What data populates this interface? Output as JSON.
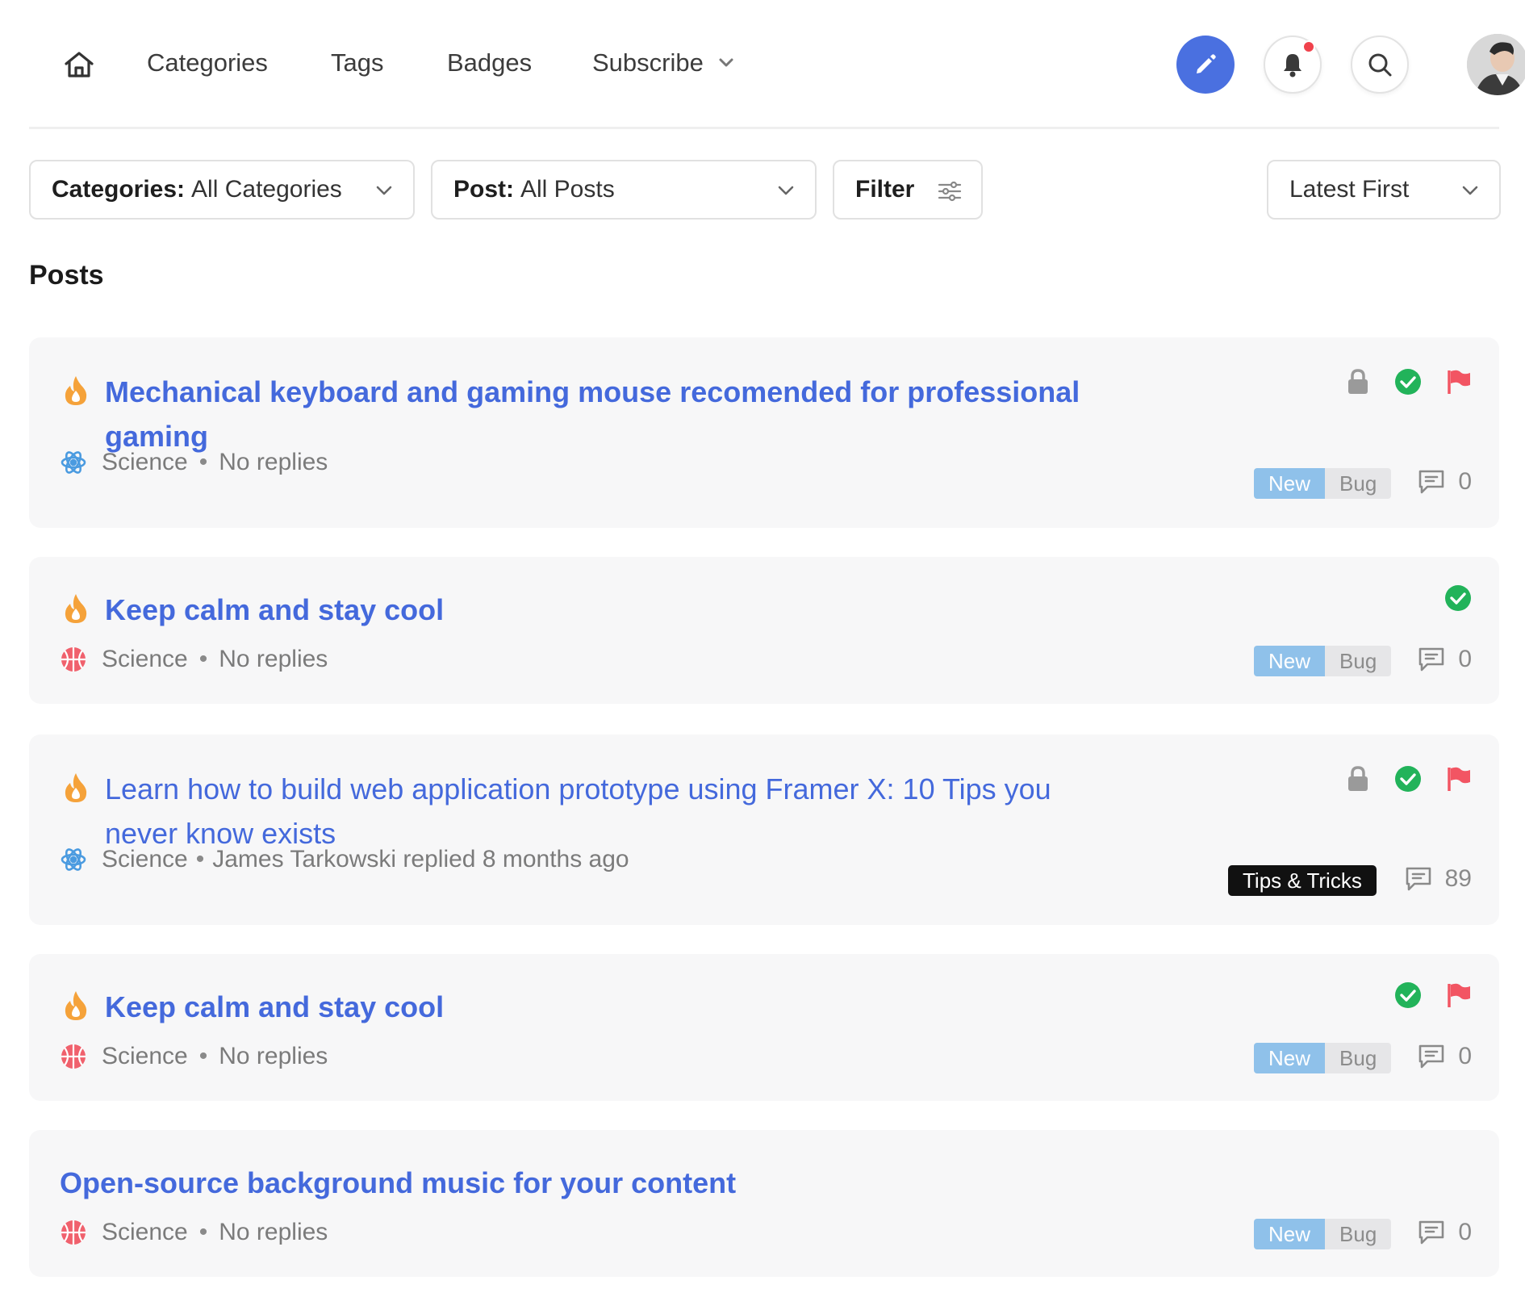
{
  "nav": {
    "home_icon": "home-icon",
    "links": [
      "Categories",
      "Tags",
      "Badges"
    ],
    "subscribe_label": "Subscribe",
    "write_icon": "pencil-icon",
    "notification_icon": "bell-icon",
    "search_icon": "search-icon",
    "avatar": "user-avatar"
  },
  "filters": {
    "categories_label": "Categories:",
    "categories_value": "All Categories",
    "post_label": "Post:",
    "post_value": "All Posts",
    "filter_label": "Filter",
    "sort_value": "Latest First"
  },
  "page_title": "Posts",
  "colors": {
    "accent": "#4a70e0",
    "title_link": "#4469dc",
    "flame": "#f5a23a",
    "check": "#22b35a",
    "flag": "#f25563",
    "tag_new": "#8fc1ea"
  },
  "posts": [
    {
      "title_line1": "Mechanical keyboard and gaming mouse recomended for professional",
      "title_line2": "gaming",
      "hot": true,
      "category": "Science",
      "category_icon": "atom-icon",
      "separator": "•",
      "activity": "No replies",
      "tags": [
        "New",
        "Bug"
      ],
      "reply_count": "0",
      "locked": true,
      "solved": true,
      "flagged": true
    },
    {
      "title_line1": "Keep calm and stay cool",
      "hot": true,
      "category": "Science",
      "category_icon": "basketball-icon",
      "separator": "•",
      "activity": "No replies",
      "tags": [
        "New",
        "Bug"
      ],
      "reply_count": "0",
      "locked": false,
      "solved": true,
      "flagged": false
    },
    {
      "title_line1": "Learn how to build web application prototype using Framer X: 10 Tips you",
      "title_line2": "never know exists",
      "hot": true,
      "category": "Science",
      "category_icon": "atom-icon",
      "separator": "•",
      "activity": "James Tarkowski replied 8 months ago",
      "tags": [
        "Tips & Tricks"
      ],
      "reply_count": "89",
      "locked": true,
      "solved": true,
      "flagged": true
    },
    {
      "title_line1": "Keep calm and stay cool",
      "hot": true,
      "category": "Science",
      "category_icon": "basketball-icon",
      "separator": "•",
      "activity": "No replies",
      "tags": [
        "New",
        "Bug"
      ],
      "reply_count": "0",
      "locked": false,
      "solved": true,
      "flagged": true
    },
    {
      "title_line1": "Open-source background music for your content",
      "hot": false,
      "category": "Science",
      "category_icon": "basketball-icon",
      "separator": "•",
      "activity": "No replies",
      "tags": [
        "New",
        "Bug"
      ],
      "reply_count": "0",
      "locked": false,
      "solved": false,
      "flagged": false
    }
  ]
}
